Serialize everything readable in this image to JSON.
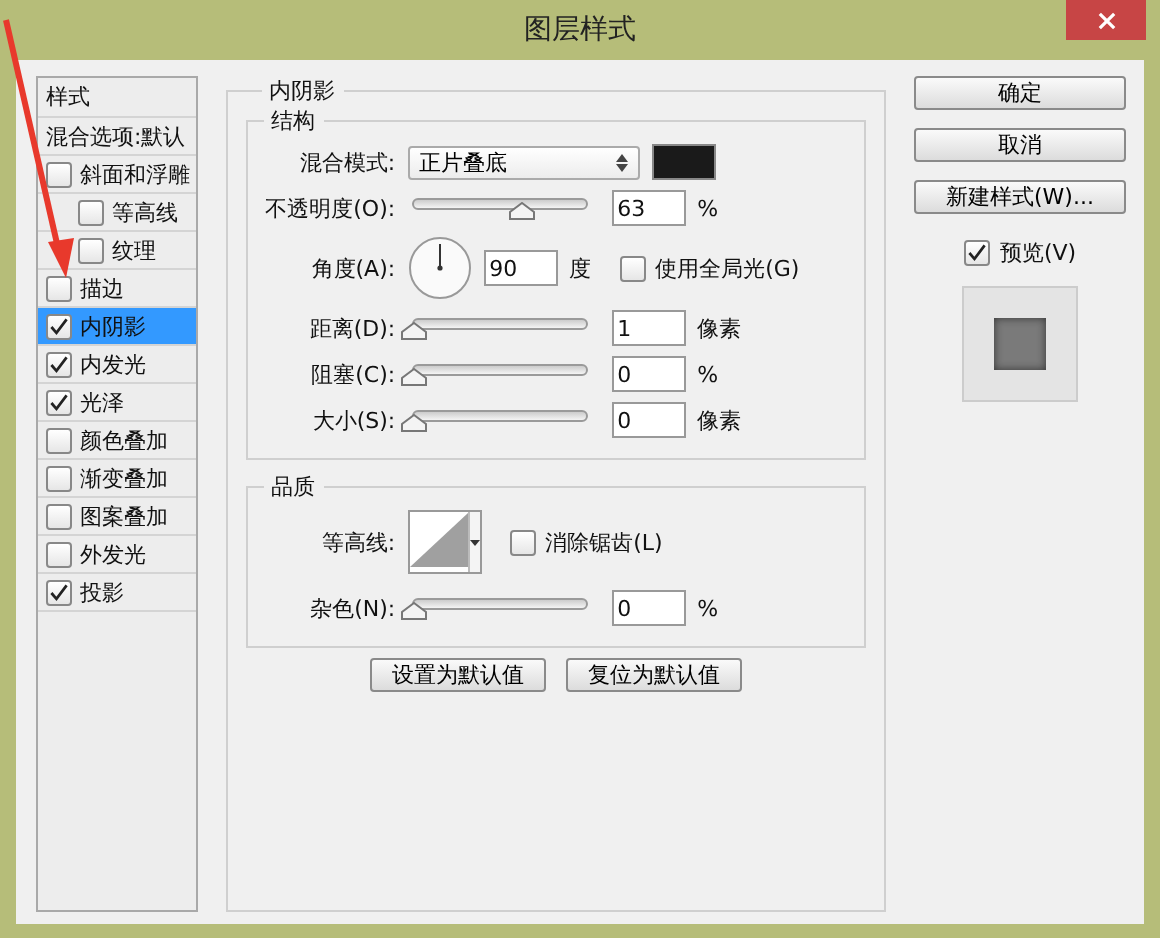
{
  "window": {
    "title": "图层样式"
  },
  "styles_list": {
    "header": "样式",
    "items": [
      {
        "label": "混合选项:默认",
        "kind": "option",
        "selected": false
      },
      {
        "label": "斜面和浮雕",
        "kind": "checkbox",
        "checked": false,
        "selected": false,
        "children": [
          {
            "label": "等高线",
            "kind": "checkbox",
            "checked": false,
            "selected": false
          },
          {
            "label": "纹理",
            "kind": "checkbox",
            "checked": false,
            "selected": false
          }
        ]
      },
      {
        "label": "描边",
        "kind": "checkbox",
        "checked": false,
        "selected": false
      },
      {
        "label": "内阴影",
        "kind": "checkbox",
        "checked": true,
        "selected": true
      },
      {
        "label": "内发光",
        "kind": "checkbox",
        "checked": true,
        "selected": false
      },
      {
        "label": "光泽",
        "kind": "checkbox",
        "checked": true,
        "selected": false
      },
      {
        "label": "颜色叠加",
        "kind": "checkbox",
        "checked": false,
        "selected": false
      },
      {
        "label": "渐变叠加",
        "kind": "checkbox",
        "checked": false,
        "selected": false
      },
      {
        "label": "图案叠加",
        "kind": "checkbox",
        "checked": false,
        "selected": false
      },
      {
        "label": "外发光",
        "kind": "checkbox",
        "checked": false,
        "selected": false
      },
      {
        "label": "投影",
        "kind": "checkbox",
        "checked": true,
        "selected": false
      }
    ]
  },
  "inner_shadow": {
    "title": "内阴影",
    "structure": {
      "title": "结构",
      "rows": [
        {
          "kind": "select",
          "label": "混合模式:",
          "value": "正片叠底"
        },
        {
          "kind": "slider",
          "label": "不透明度(O):",
          "level": 0.63,
          "value": "63",
          "unit": "%"
        },
        {
          "kind": "angle",
          "label": "角度(A):",
          "value": "90",
          "unit": "度",
          "option": {
            "label": "使用全局光(G)",
            "checked": false
          }
        },
        {
          "kind": "slider",
          "label": "距离(D):",
          "level": 0,
          "value": "1",
          "unit": "像素"
        },
        {
          "kind": "slider",
          "label": "阻塞(C):",
          "level": 0,
          "value": "0",
          "unit": "%"
        },
        {
          "kind": "slider",
          "label": "大小(S):",
          "level": 0,
          "value": "0",
          "unit": "像素"
        }
      ]
    },
    "quality": {
      "title": "品质",
      "rows": [
        {
          "kind": "contour",
          "label": "等高线:",
          "option": {
            "label": "消除锯齿(L)",
            "checked": false
          }
        },
        {
          "kind": "slider",
          "label": "杂色(N):",
          "level": 0,
          "value": "0",
          "unit": "%"
        }
      ]
    },
    "buttons": [
      "设置为默认值",
      "复位为默认值"
    ]
  },
  "side": {
    "buttons": [
      "确定",
      "取消",
      "新建样式(W)..."
    ],
    "preview": {
      "label": "预览(V)",
      "checked": true
    }
  }
}
